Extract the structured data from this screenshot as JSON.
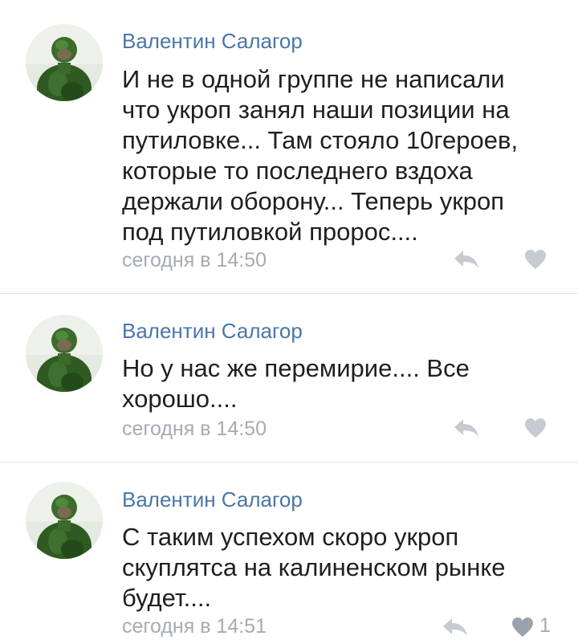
{
  "comments": [
    {
      "author": "Валентин Салагор",
      "lines": [
        "И не в одной группе не написали",
        "что укроп занял наши позиции на",
        "путиловке... Там стояло 10героев,",
        "которые то последнего вздоха",
        "держали оборону... Теперь укроп",
        "под путиловкой пророс...."
      ],
      "time": "сегодня в 14:50",
      "likes": ""
    },
    {
      "author": "Валентин Салагор",
      "lines": [
        "Но у нас же перемирие.... Все",
        "хорошо...."
      ],
      "time": "сегодня в 14:50",
      "likes": ""
    },
    {
      "author": "Валентин Салагор",
      "lines": [
        "С таким успехом скоро укроп",
        "скуплятса на калиненском рынке",
        "будет...."
      ],
      "time": "сегодня в 14:51",
      "likes": "1"
    }
  ],
  "colors": {
    "author": "#4a76a8",
    "text": "#1f1f1f",
    "meta": "#a4abb3",
    "divider": "#e1e4e8",
    "icon": "#c5cbd1",
    "icon_active": "#99a2ad"
  },
  "icons": {
    "reply": "reply-arrow-icon",
    "like": "heart-icon"
  }
}
